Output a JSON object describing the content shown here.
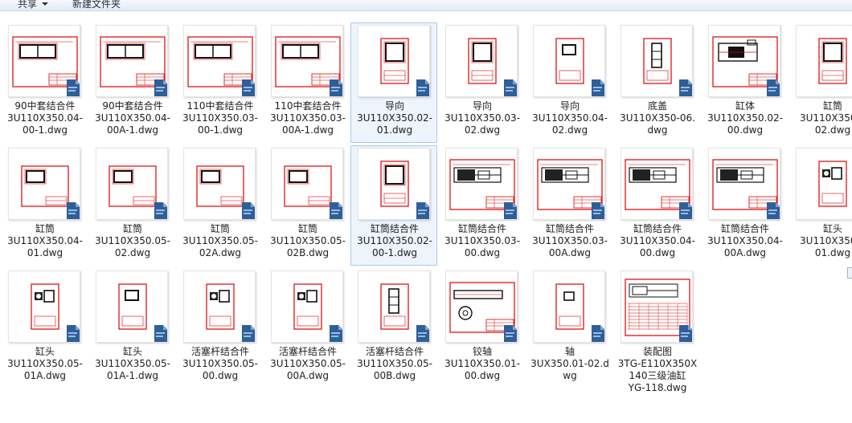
{
  "toolbar": {
    "share_label": "共享",
    "new_folder_label": "新建文件夹"
  },
  "colors": {
    "drawing": "#e00000",
    "badge": "#2e5f99",
    "hover_bg": "#edf4fc"
  },
  "files": [
    {
      "label": "90中套结合件\n3U110X350.04-\n00-1.dwg",
      "thumb": "wide-frame"
    },
    {
      "label": "90中套结合件\n3U110X350.04-\n00A-1.dwg",
      "thumb": "wide-frame"
    },
    {
      "label": "110中套结合件\n3U110X350.03-\n00-1.dwg",
      "thumb": "wide-frame"
    },
    {
      "label": "110中套结合件\n3U110X350.03-\n00A-1.dwg",
      "thumb": "wide-frame"
    },
    {
      "label": "导向\n3U110X350.02-\n01.dwg",
      "thumb": "tall-box"
    },
    {
      "label": "导向\n3U110X350.03-\n02.dwg",
      "thumb": "tall-box"
    },
    {
      "label": "导向\n3U110X350.04-\n02.dwg",
      "thumb": "small-box"
    },
    {
      "label": "底盖\n3U110X350-06.\ndwg",
      "thumb": "tall-bolt"
    },
    {
      "label": "缸体\n3U110X350.02-\n00.dwg",
      "thumb": "assembly"
    },
    {
      "label": "缸筒\n3U110X350.0\n02.dwg",
      "thumb": "tall-box"
    },
    {
      "label": "缸筒\n3U110X350.04-\n01.dwg",
      "thumb": "small-frame"
    },
    {
      "label": "缸筒\n3U110X350.05-\n02.dwg",
      "thumb": "small-frame"
    },
    {
      "label": "缸筒\n3U110X350.05-\n02A.dwg",
      "thumb": "small-frame"
    },
    {
      "label": "缸筒\n3U110X350.05-\n02B.dwg",
      "thumb": "small-frame"
    },
    {
      "label": "缸筒结合件\n3U110X350.02-\n00-1.dwg",
      "thumb": "tall-box"
    },
    {
      "label": "缸筒结合件\n3U110X350.03-\n00.dwg",
      "thumb": "long-assembly"
    },
    {
      "label": "缸筒结合件\n3U110X350.03-\n00A.dwg",
      "thumb": "long-assembly"
    },
    {
      "label": "缸筒结合件\n3U110X350.04-\n00.dwg",
      "thumb": "long-assembly"
    },
    {
      "label": "缸筒结合件\n3U110X350.04-\n00A.dwg",
      "thumb": "long-assembly"
    },
    {
      "label": "缸头\n3U110X350.0\n01.dwg",
      "thumb": "head"
    },
    {
      "label": "缸头\n3U110X350.05-\n01A.dwg",
      "thumb": "head"
    },
    {
      "label": "缸头\n3U110X350.05-\n01A-1.dwg",
      "thumb": "small-box"
    },
    {
      "label": "活塞杆结合件\n3U110X350.05-\n00.dwg",
      "thumb": "head"
    },
    {
      "label": "活塞杆结合件\n3U110X350.05-\n00A.dwg",
      "thumb": "head"
    },
    {
      "label": "活塞杆结合件\n3U110X350.05-\n00B.dwg",
      "thumb": "tall-bolt"
    },
    {
      "label": "铰轴\n3U110X350.01-\n00.dwg",
      "thumb": "shaft"
    },
    {
      "label": "轴\n3UX350.01-02.d\nwg",
      "thumb": "tiny"
    },
    {
      "label": "装配图\n3TG-E110X350X\n140三级油缸\nYG-118.dwg",
      "thumb": "table"
    }
  ]
}
